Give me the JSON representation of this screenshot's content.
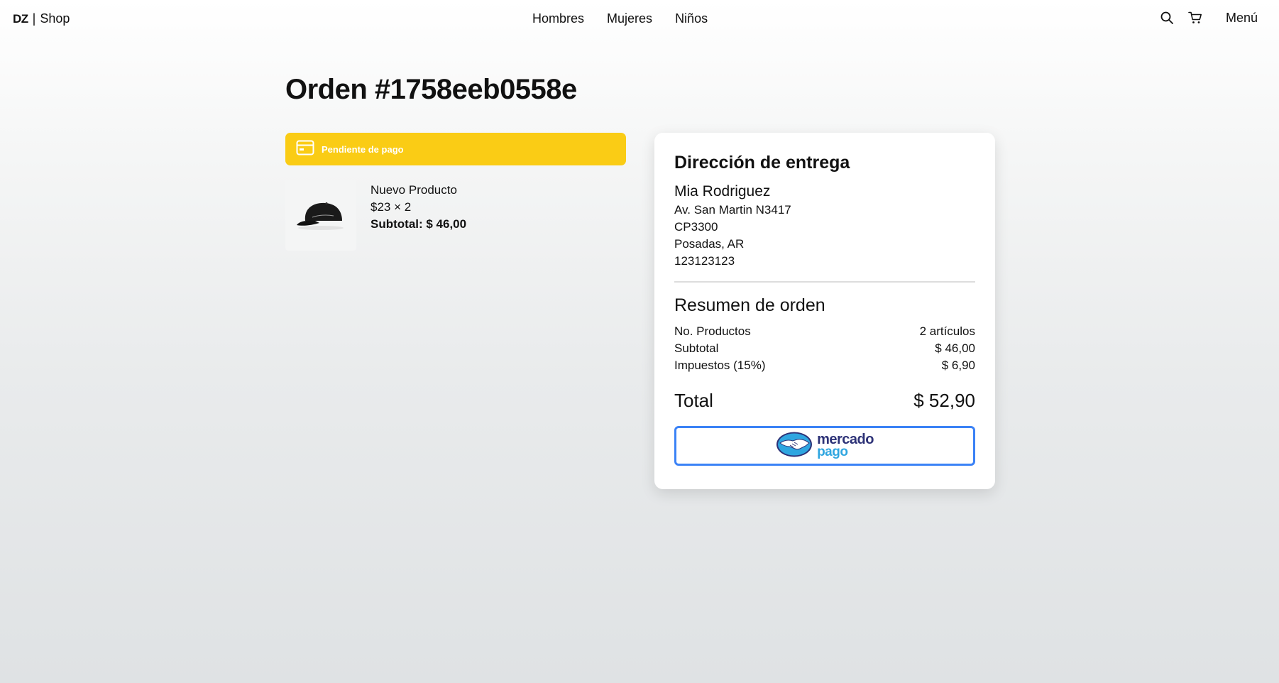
{
  "nav": {
    "logo": "DZ",
    "separator": "|",
    "shop": "Shop",
    "links": [
      "Hombres",
      "Mujeres",
      "Niños"
    ],
    "icons": [
      "search-icon",
      "cart-icon"
    ],
    "menu_label": "Menú"
  },
  "order": {
    "title": "Orden #1758eeb0558e",
    "status": {
      "label": "Pendiente de pago",
      "icon": "credit-card-icon",
      "color": "#facc15"
    }
  },
  "items": [
    {
      "name": "Nuevo Producto",
      "price_qty": "$23 × 2",
      "subtotal": "Subtotal: $ 46,00",
      "image": "black-cap"
    }
  ],
  "delivery": {
    "heading": "Dirección de entrega",
    "name": "Mia Rodriguez",
    "street": "Av. San Martin N3417",
    "zip": "CP3300",
    "city": "Posadas, AR",
    "phone": "123123123"
  },
  "summary": {
    "heading": "Resumen de orden",
    "rows": [
      {
        "label": "No. Productos",
        "value": "2 artículos"
      },
      {
        "label": "Subtotal",
        "value": "$ 46,00"
      },
      {
        "label": "Impuestos (15%)",
        "value": "$ 6,90"
      }
    ],
    "total_label": "Total",
    "total_value": "$ 52,90"
  },
  "payment": {
    "brand_top": "mercado",
    "brand_bottom": "pago",
    "border_color": "#3b82f6"
  }
}
